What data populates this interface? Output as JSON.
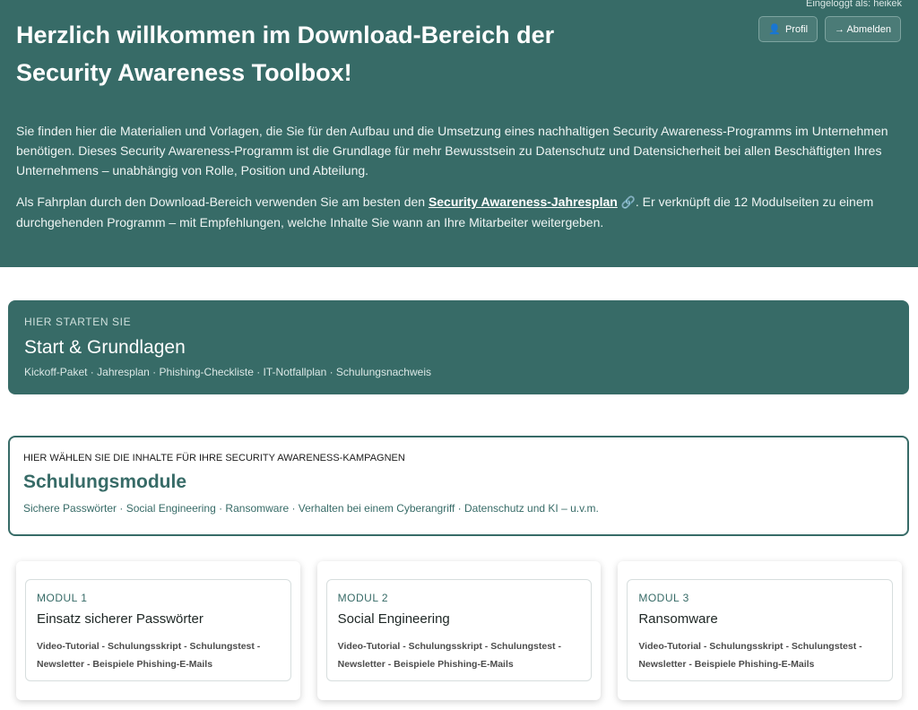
{
  "header": {
    "login_info": "Eingeloggt als: heikek",
    "profile_icon": "user-icon",
    "profile_label": "Profil",
    "logout_label": "→ Abmelden",
    "title": "Herzlich willkommen im Download-Bereich der Security Awareness Toolbox!",
    "intro_p1": "Sie finden hier die Materialien und Vorlagen, die Sie für den Aufbau und die Umsetzung eines nachhaltigen Security Awareness-Programms im Unternehmen benötigen. Dieses Security Awareness-Programm ist die Grundlage für mehr Bewusstsein zu Datenschutz und Datensicherheit bei allen Beschäftigten Ihres Unternehmens – unabhängig von Rolle, Position und Abteilung.",
    "intro_p2_prefix": "Als Fahrplan durch den Download-Bereich verwenden Sie am besten den ",
    "intro_p2_link": "Security Awareness-Jahresplan",
    "intro_p2_link_icon": "link-icon",
    "intro_p2_suffix": ". Er verknüpft die 12 Modulseiten zu einem durchgehenden Programm – mit Empfehlungen, welche Inhalte Sie wann an Ihre Mitarbeiter weitergeben."
  },
  "start": {
    "eyebrow": "HIER STARTEN SIE",
    "title": "Start & Grundlagen",
    "items": "Kickoff-Paket · Jahresplan · Phishing-Checkliste · IT-Notfallplan · Schulungsnachweis"
  },
  "modules": {
    "eyebrow": "HIER WÄHLEN SIE DIE INHALTE FÜR IHRE SECURITY AWARENESS-KAMPAGNEN",
    "title": "Schulungsmodule",
    "items": "Sichere Passwörter · Social Engineering · Ransomware · Verhalten bei einem Cyberangriff · Datenschutz und KI – u.v.m."
  },
  "tiles": [
    {
      "eyebrow": "MODUL 1",
      "title": "Einsatz sicherer Passwörter",
      "items": "Video-Tutorial - Schulungsskript - Schulungstest - Newsletter - Beispiele Phishing-E-Mails"
    },
    {
      "eyebrow": "MODUL 2",
      "title": "Social Engineering",
      "items": "Video-Tutorial - Schulungsskript - Schulungstest - Newsletter - Beispiele Phishing-E-Mails"
    },
    {
      "eyebrow": "MODUL 3",
      "title": "Ransomware",
      "items": "Video-Tutorial - Schulungsskript - Schulungstest - Newsletter - Beispiele Phishing-E-Mails"
    }
  ],
  "colors": {
    "brand": "#376b67",
    "background": "#ffffff"
  }
}
